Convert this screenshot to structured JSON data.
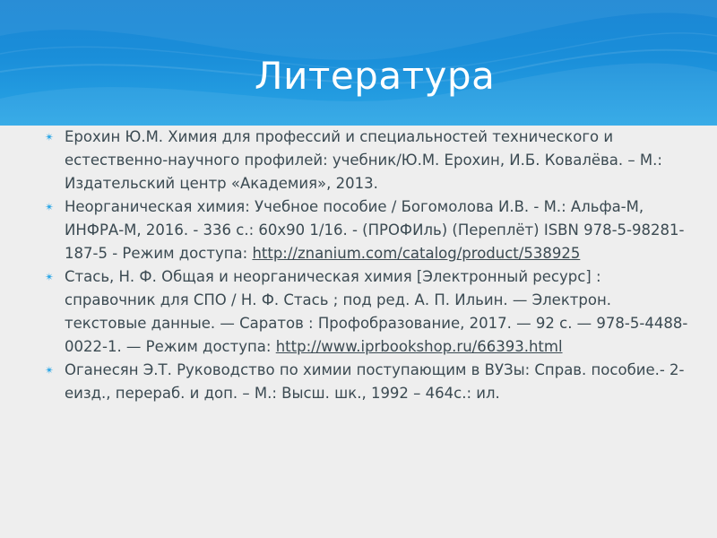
{
  "slide": {
    "title": "Литература",
    "accent_color": "#1a8ed9",
    "bullet_icon": "star-icon",
    "bullet_glyph": "✴",
    "references": [
      {
        "text": "Ерохин Ю.М. Химия  для профессий и специальностей технического и естественно-научного профилей: учебник/Ю.М. Ерохин, И.Б. Ковалёва. – М.: Издательский центр «Академия», 2013.",
        "link": ""
      },
      {
        "text": "Неорганическая химия: Учебное пособие / Богомолова И.В. - М.: Альфа-М, ИНФРА-М, 2016. - 336 с.: 60x90 1/16. - (ПРОФИль) (Переплёт) ISBN 978-5-98281-187-5 - Режим доступа: ",
        "link": "http://znanium.com/catalog/product/538925"
      },
      {
        "text": "Стась, Н. Ф. Общая и неорганическая химия [Электронный ресурс] : справочник для СПО / Н. Ф. Стась ; под ред. А. П. Ильин. — Электрон. текстовые данные. — Саратов : Профобразование, 2017. — 92 c. — 978-5-4488-0022-1. — Режим доступа: ",
        "link": "http://www.iprbookshop.ru/66393.html"
      },
      {
        "text": "Оганесян Э.Т. Руководство по химии поступающим в ВУЗы: Справ. пособие.- 2-еизд., перераб. и доп. – М.: Высш. шк., 1992 – 464с.: ил.",
        "link": ""
      }
    ]
  }
}
